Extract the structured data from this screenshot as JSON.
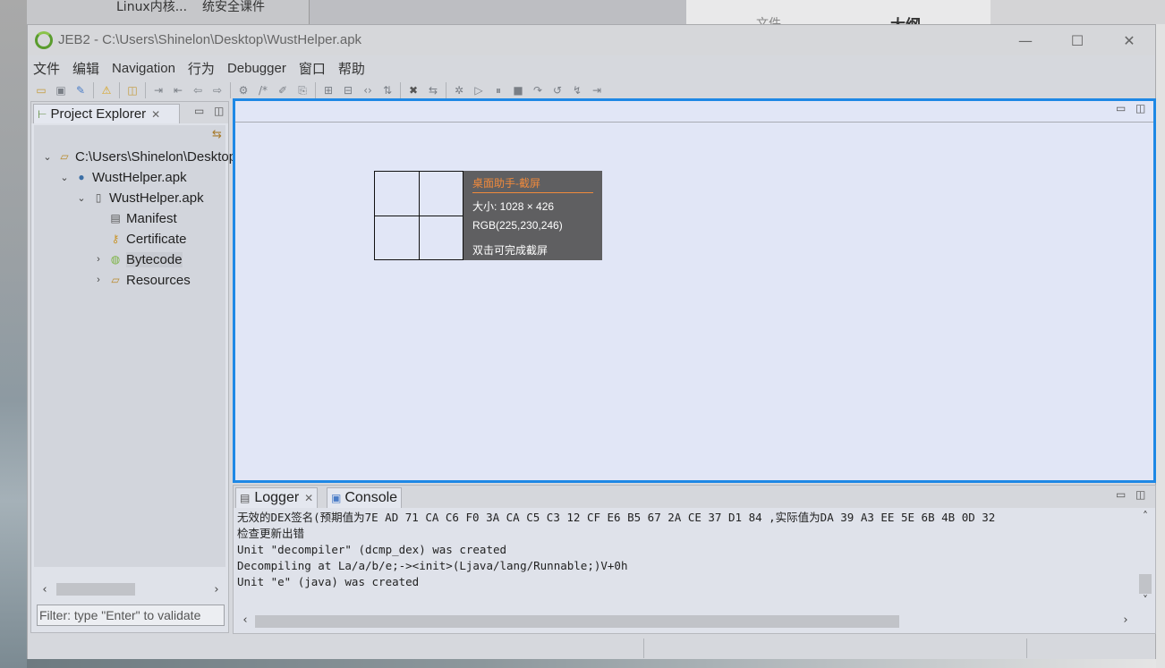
{
  "desktop": {
    "top_text_1": "Linux内核...",
    "top_text_2": "统安全课件",
    "top_text_3": "文件",
    "top_text_4": "大纲"
  },
  "window": {
    "title": "JEB2 - C:\\Users\\Shinelon\\Desktop\\WustHelper.apk",
    "minimize": "—",
    "maximize": "☐",
    "close": "✕"
  },
  "menu": [
    "文件",
    "编辑",
    "Navigation",
    "行为",
    "Debugger",
    "窗口",
    "帮助"
  ],
  "explorer": {
    "tab_label": "Project Explorer",
    "filter_placeholder": "Filter: type \"Enter\" to validate",
    "tree": [
      {
        "label": "C:\\Users\\Shinelon\\Desktop",
        "icon": "folder-open-icon",
        "expanded": true
      },
      {
        "label": "WustHelper.apk",
        "icon": "artifact-dot-icon",
        "expanded": true
      },
      {
        "label": "WustHelper.apk",
        "icon": "apk-file-icon",
        "expanded": true
      },
      {
        "label": "Manifest",
        "icon": "manifest-file-icon"
      },
      {
        "label": "Certificate",
        "icon": "key-icon"
      },
      {
        "label": "Bytecode",
        "icon": "android-icon",
        "expanded": false,
        "selected": true
      },
      {
        "label": "Resources",
        "icon": "folder-icon",
        "expanded": false
      }
    ]
  },
  "screenshot_tip": {
    "title": "桌面助手-截屏",
    "size": "大小: 1028 × 426",
    "rgb": "RGB(225,230,246)",
    "action": "双击可完成截屏"
  },
  "logger": {
    "tab_logger": "Logger",
    "tab_console": "Console",
    "lines": [
      "无效的DEX签名(预期值为7E AD 71 CA C6 F0 3A CA C5 C3 12 CF E6 B5 67 2A CE 37 D1 84 ,实际值为DA 39 A3 EE 5E 6B 4B 0D 32",
      "检查更新出错",
      "Unit \"decompiler\" (dcmp_dex) was created",
      "Decompiling at La/a/b/e;-><init>(Ljava/lang/Runnable;)V+0h",
      "Unit \"e\" (java) was created"
    ]
  },
  "colors": {
    "editor_bg": "#e1e6f6",
    "focus_border": "#1e88e5",
    "tip_accent": "#f08a3c"
  }
}
